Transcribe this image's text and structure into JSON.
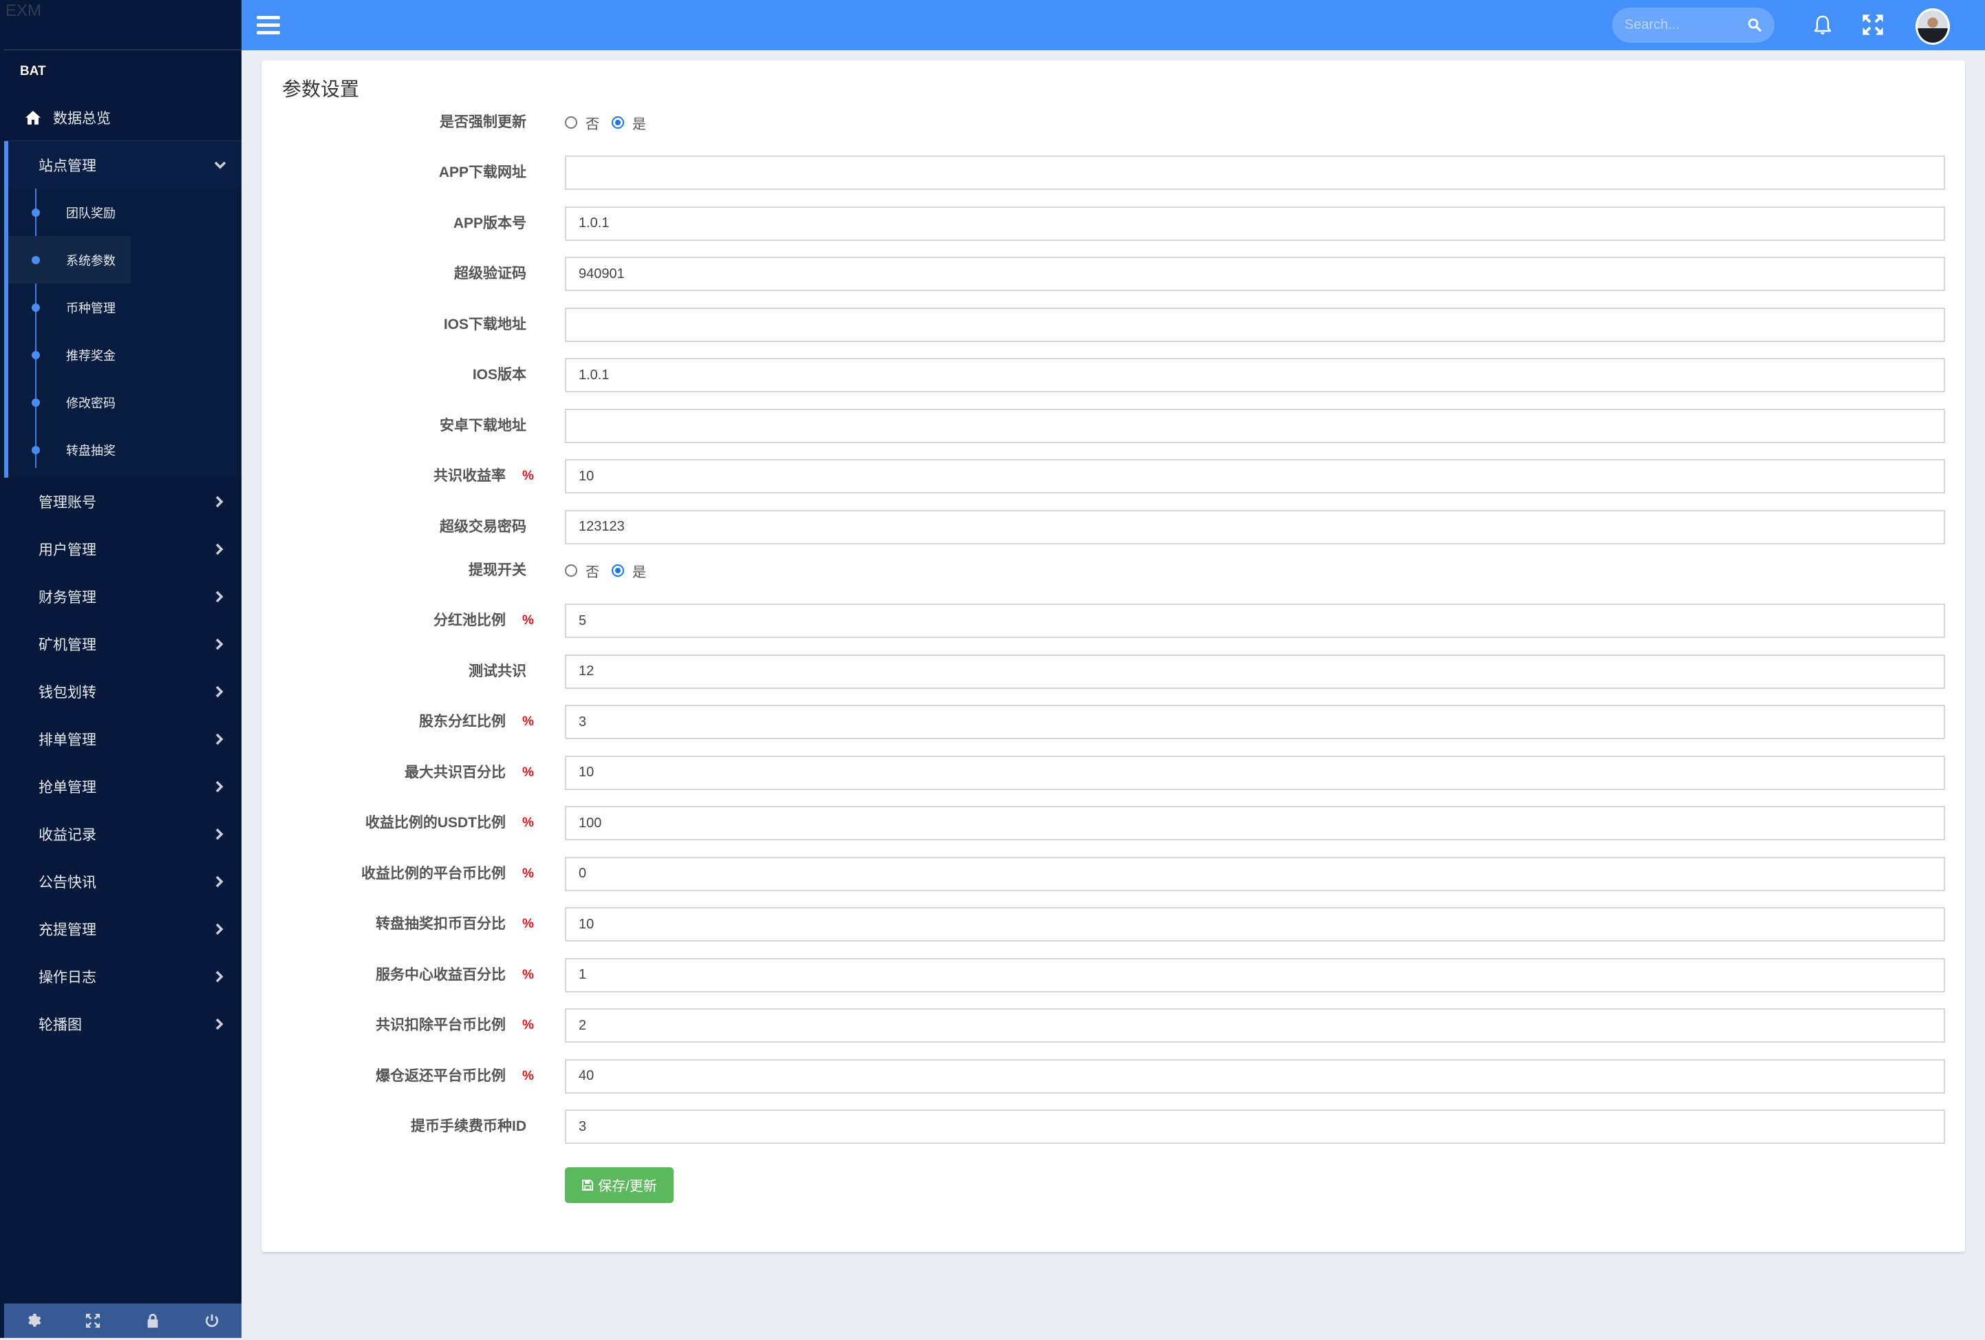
{
  "brand": {
    "logo_text": "EXM",
    "section_title": "BAT"
  },
  "sidebar": {
    "home": {
      "label": "数据总览",
      "icon": "home-icon"
    },
    "open_group": {
      "label": "站点管理",
      "items": [
        {
          "label": "团队奖励",
          "active": false
        },
        {
          "label": "系统参数",
          "active": true
        },
        {
          "label": "币种管理",
          "active": false
        },
        {
          "label": "推荐奖金",
          "active": false
        },
        {
          "label": "修改密码",
          "active": false
        },
        {
          "label": "转盘抽奖",
          "active": false
        }
      ]
    },
    "groups": [
      {
        "label": "管理账号"
      },
      {
        "label": "用户管理"
      },
      {
        "label": "财务管理"
      },
      {
        "label": "矿机管理"
      },
      {
        "label": "钱包划转"
      },
      {
        "label": "排单管理"
      },
      {
        "label": "抢单管理"
      },
      {
        "label": "收益记录"
      },
      {
        "label": "公告快讯"
      },
      {
        "label": "充提管理"
      },
      {
        "label": "操作日志"
      },
      {
        "label": "轮播图"
      }
    ],
    "footer_icons": [
      "gear-icon",
      "fullscreen-icon",
      "lock-icon",
      "power-icon"
    ]
  },
  "header": {
    "search_placeholder": "Search...",
    "icons": [
      "menu-icon",
      "search-icon",
      "bell-icon",
      "fullscreen-icon",
      "avatar"
    ]
  },
  "colors": {
    "header": "#4390fb",
    "sidebar": "#06193a",
    "accent": "#4a8cf0",
    "save": "#5cb85c",
    "percent": "#e0141e"
  },
  "page": {
    "title": "参数设置",
    "fields": [
      {
        "label": "是否强制更新",
        "type": "radio",
        "options": [
          "否",
          "是"
        ],
        "selected": "是"
      },
      {
        "label": "APP下载网址",
        "type": "text",
        "value": ""
      },
      {
        "label": "APP版本号",
        "type": "text",
        "value": "1.0.1"
      },
      {
        "label": "超级验证码",
        "type": "text",
        "value": "940901"
      },
      {
        "label": "IOS下载地址",
        "type": "text",
        "value": ""
      },
      {
        "label": "IOS版本",
        "type": "text",
        "value": "1.0.1"
      },
      {
        "label": "安卓下载地址",
        "type": "text",
        "value": ""
      },
      {
        "label": "共识收益率",
        "type": "text",
        "value": "10",
        "unit": "%"
      },
      {
        "label": "超级交易密码",
        "type": "text",
        "value": "123123"
      },
      {
        "label": "提现开关",
        "type": "radio",
        "options": [
          "否",
          "是"
        ],
        "selected": "是"
      },
      {
        "label": "分红池比例",
        "type": "text",
        "value": "5",
        "unit": "%"
      },
      {
        "label": "测试共识",
        "type": "text",
        "value": "12"
      },
      {
        "label": "股东分红比例",
        "type": "text",
        "value": "3",
        "unit": "%"
      },
      {
        "label": "最大共识百分比",
        "type": "text",
        "value": "10",
        "unit": "%"
      },
      {
        "label": "收益比例的USDT比例",
        "type": "text",
        "value": "100",
        "unit": "%"
      },
      {
        "label": "收益比例的平台币比例",
        "type": "text",
        "value": "0",
        "unit": "%"
      },
      {
        "label": "转盘抽奖扣币百分比",
        "type": "text",
        "value": "10",
        "unit": "%"
      },
      {
        "label": "服务中心收益百分比",
        "type": "text",
        "value": "1",
        "unit": "%"
      },
      {
        "label": "共识扣除平台币比例",
        "type": "text",
        "value": "2",
        "unit": "%"
      },
      {
        "label": "爆仓返还平台币比例",
        "type": "text",
        "value": "40",
        "unit": "%"
      },
      {
        "label": "提币手续费币种ID",
        "type": "text",
        "value": "3"
      }
    ],
    "save_label": "保存/更新"
  }
}
